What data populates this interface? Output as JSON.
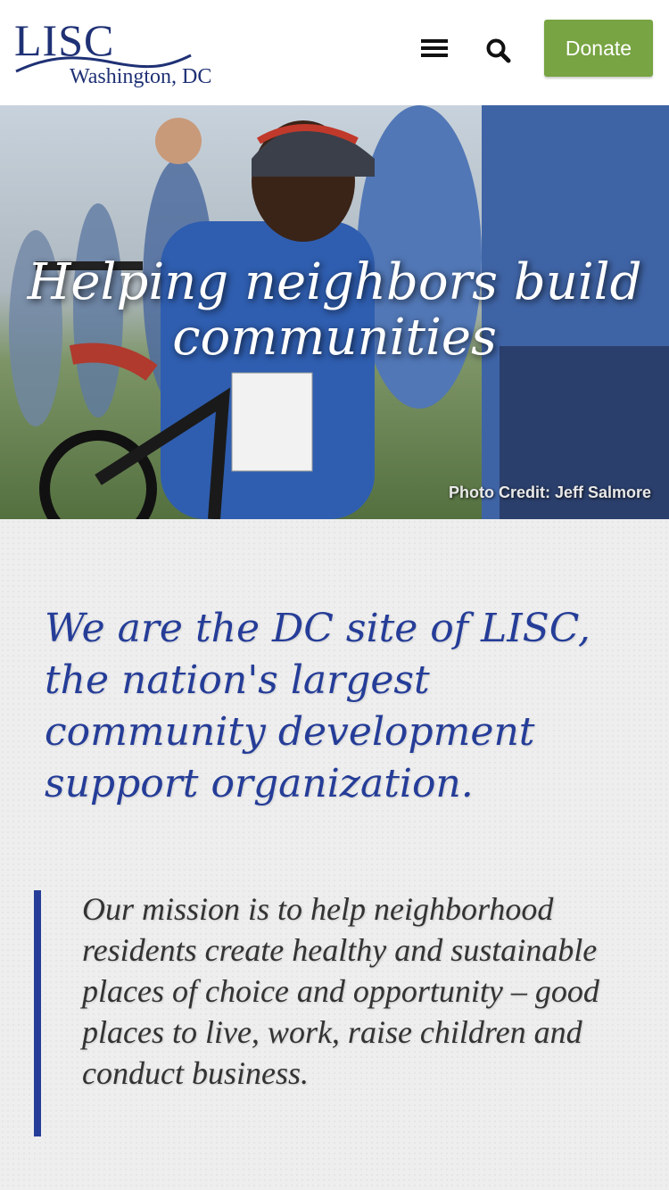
{
  "header": {
    "logo_text": "LISC",
    "logo_subtext": "Washington, DC",
    "menu_icon": "hamburger-menu-icon",
    "search_icon": "search-icon",
    "donate_label": "Donate",
    "donate_color": "#78a443"
  },
  "hero": {
    "title": "Helping neighbors build communities",
    "photo_credit": "Photo Credit: Jeff Salmore"
  },
  "content": {
    "intro": "We are the DC site of LISC, the nation's largest community development support organization.",
    "mission": "Our mission is to help neighborhood residents create healthy and sustainable places of choice and opportunity – good places to live, work, raise children and conduct business.",
    "accent_color": "#253d98"
  }
}
